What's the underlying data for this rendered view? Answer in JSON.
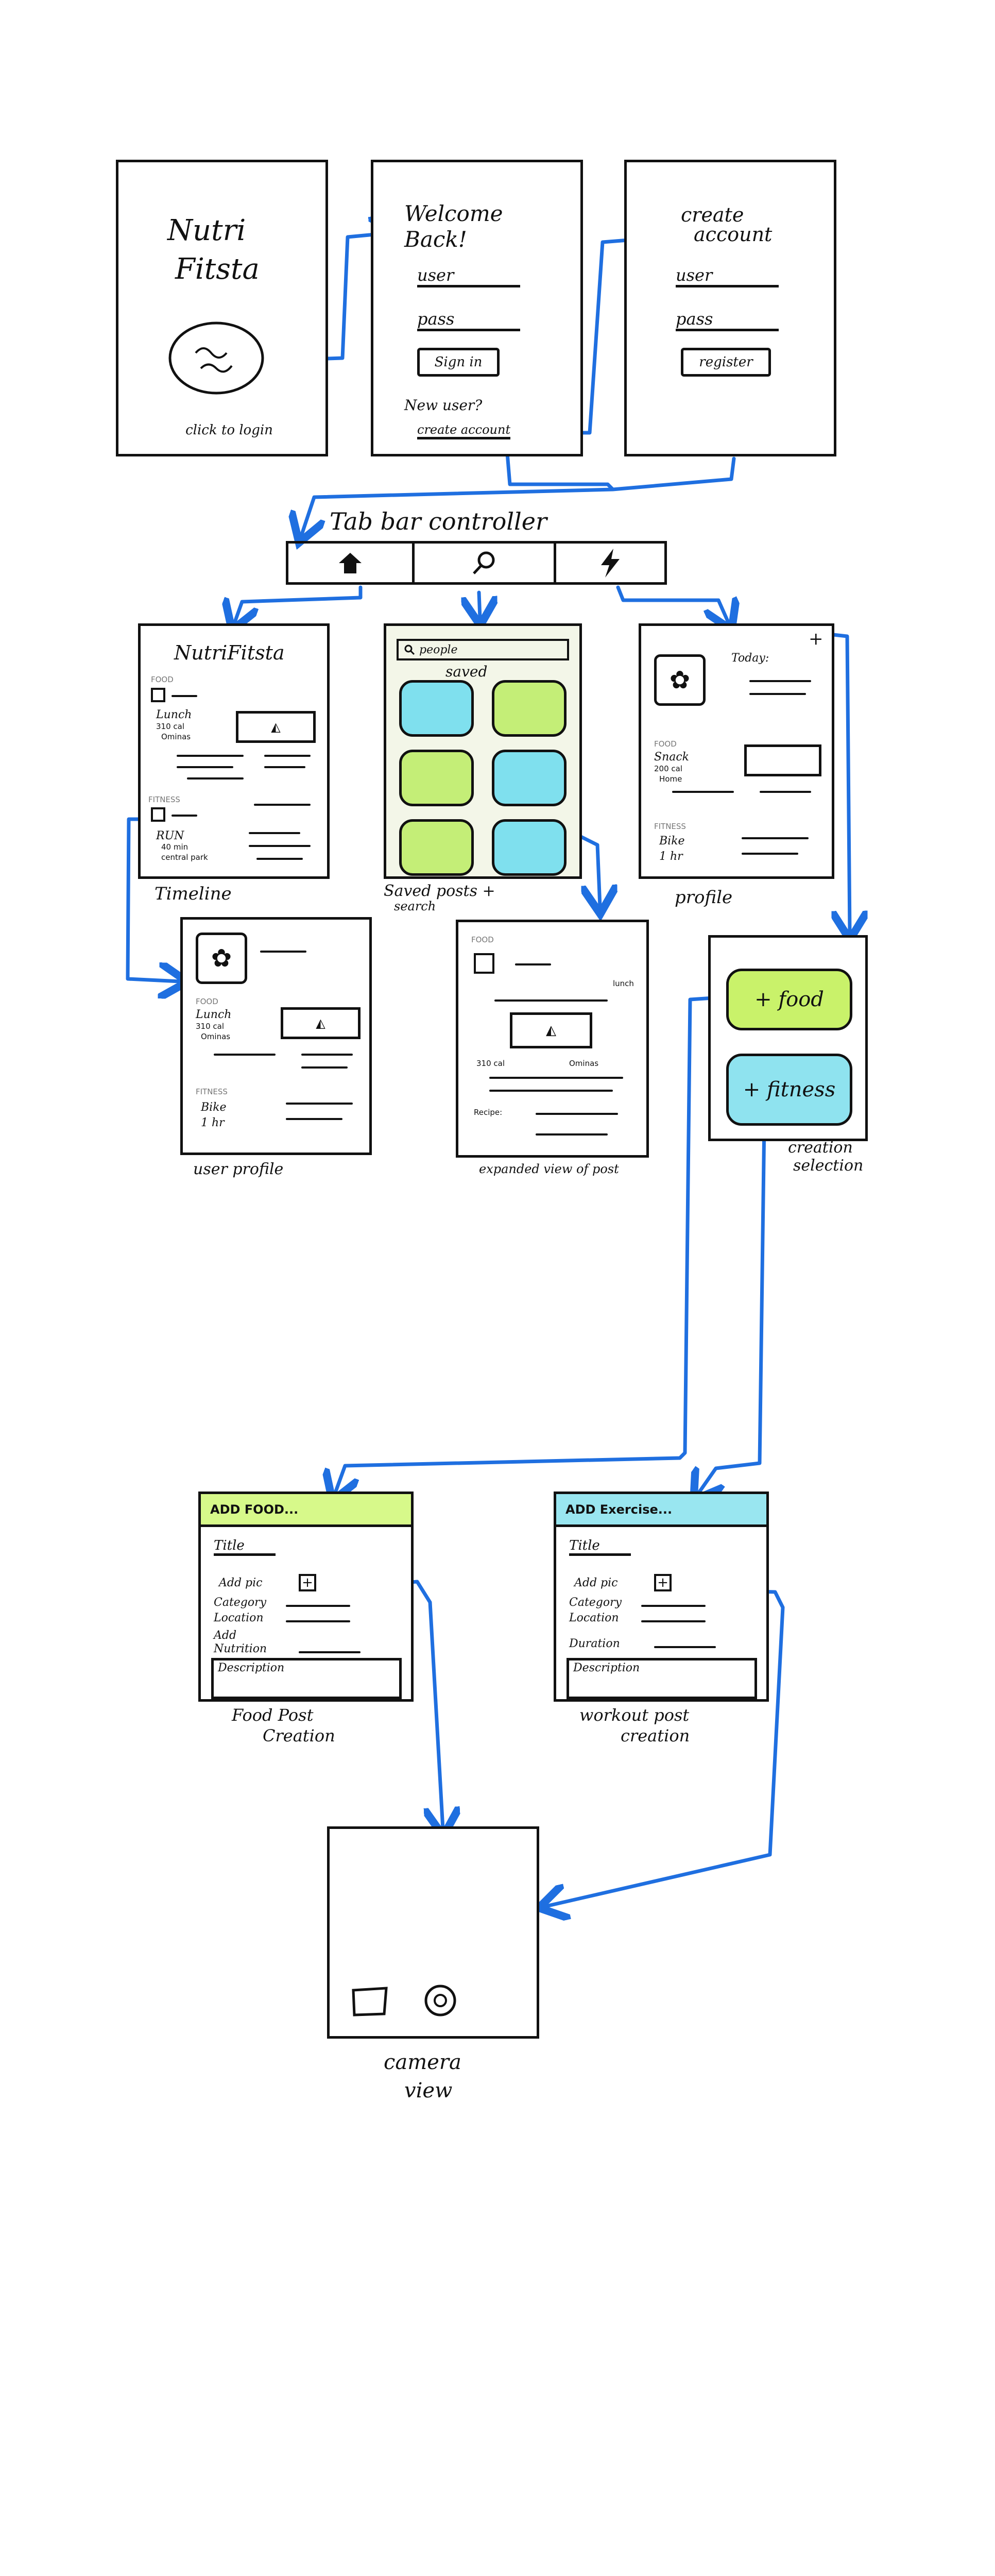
{
  "colors": {
    "arrow": "#1f6fe0",
    "food_green": "#c9f26a",
    "fitness_cyan": "#8fe3ef",
    "search_cyan": "#7fe0ee",
    "search_green": "#c4ee77",
    "ink": "#111111"
  },
  "login_flow": {
    "splash": {
      "title_line1": "Nutri",
      "title_line2": "Fitsta",
      "caption": "click to login"
    },
    "welcome": {
      "title_line1": "Welcome",
      "title_line2": "Back!",
      "user_label": "user",
      "pass_label": "pass",
      "signin_button": "Sign in",
      "new_user": "New user?",
      "create_link": "create account"
    },
    "create": {
      "title_line1": "create",
      "title_line2": "account",
      "user_label": "user",
      "pass_label": "pass",
      "register_button": "register"
    }
  },
  "tab_bar": {
    "title": "Tab bar controller",
    "icons": [
      "home-icon",
      "search-icon",
      "lightning-icon"
    ]
  },
  "timeline": {
    "title": "NutriFitsta",
    "food_label": "FOOD",
    "meal": "Lunch",
    "calories": "310 cal",
    "place": "Ominas",
    "fitness_label": "FITNESS",
    "activity": "RUN",
    "duration": "40 min",
    "location": "central park",
    "caption": "Timeline"
  },
  "search": {
    "search_placeholder": "people",
    "saved_label": "saved",
    "caption_line1": "Saved posts +",
    "caption_line2": "search"
  },
  "profile": {
    "today_label": "Today:",
    "food_label": "FOOD",
    "meal": "Snack",
    "calories": "200 cal",
    "place": "Home",
    "fitness_label": "FITNESS",
    "activity": "Bike",
    "duration": "1 hr",
    "plus": "+",
    "caption": "profile"
  },
  "user_profile": {
    "food_label": "FOOD",
    "meal": "Lunch",
    "calories": "310 cal",
    "place": "Ominas",
    "fitness_label": "FITNESS",
    "activity": "Bike",
    "duration": "1 hr",
    "caption": "user profile"
  },
  "expanded_post": {
    "food_label": "FOOD",
    "meal": "lunch",
    "calories": "310 cal",
    "place": "Ominas",
    "recipe": "Recipe:",
    "caption": "expanded view of post"
  },
  "creation_selection": {
    "food_button": "+ food",
    "fitness_button": "+ fitness",
    "caption_line1": "creation",
    "caption_line2": "selection"
  },
  "food_post": {
    "header": "ADD FOOD...",
    "title_label": "Title",
    "add_pic": "Add pic",
    "category": "Category",
    "location": "Location",
    "add_nutrition_1": "Add",
    "add_nutrition_2": "Nutrition",
    "description": "Description",
    "caption_line1": "Food Post",
    "caption_line2": "Creation"
  },
  "workout_post": {
    "header": "ADD Exercise...",
    "title_label": "Title",
    "add_pic": "Add pic",
    "category": "Category",
    "location": "Location",
    "duration": "Duration",
    "description": "Description",
    "caption_line1": "workout post",
    "caption_line2": "creation"
  },
  "camera": {
    "caption_line1": "camera",
    "caption_line2": "view"
  }
}
